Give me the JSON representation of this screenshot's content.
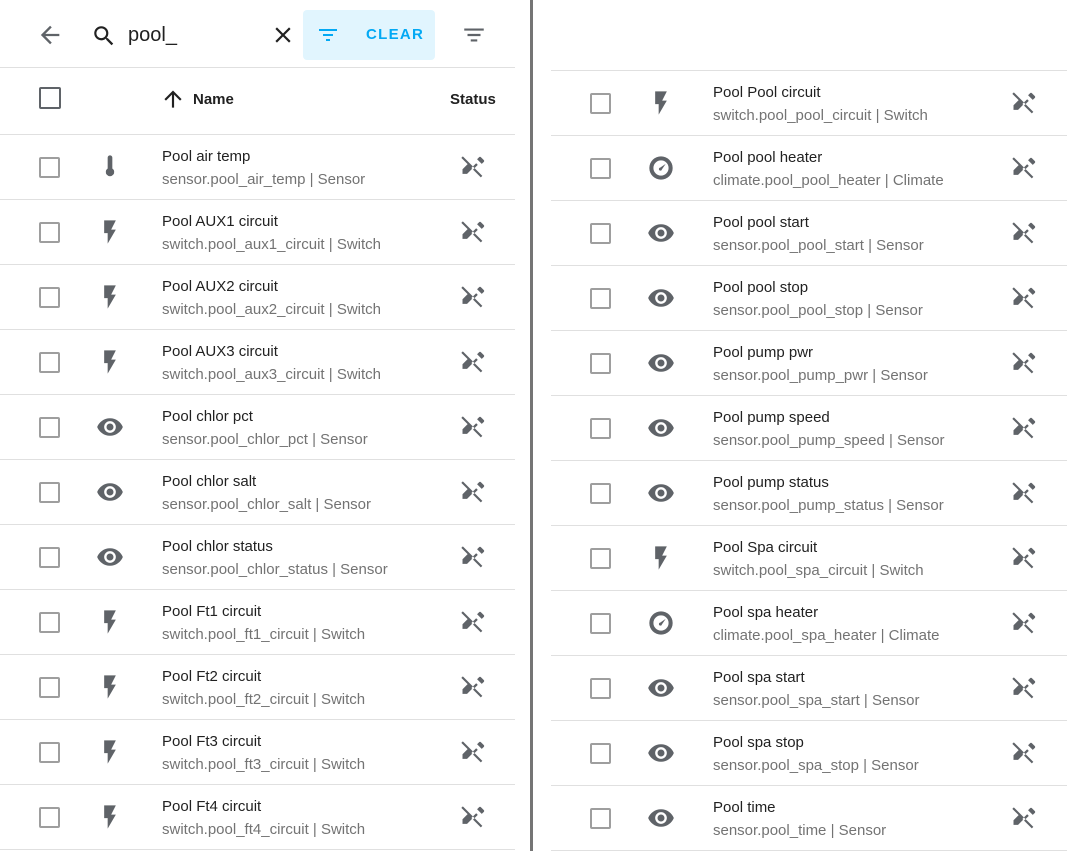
{
  "search": {
    "value": "pool_"
  },
  "toolbar": {
    "clear_label": "CLEAR"
  },
  "header": {
    "name_label": "Name",
    "status_label": "Status"
  },
  "left_rows": [
    {
      "name": "Pool air temp",
      "entity": "sensor.pool_air_temp | Sensor",
      "icon": "thermometer-icon"
    },
    {
      "name": "Pool AUX1 circuit",
      "entity": "switch.pool_aux1_circuit | Switch",
      "icon": "flash-icon"
    },
    {
      "name": "Pool AUX2 circuit",
      "entity": "switch.pool_aux2_circuit | Switch",
      "icon": "flash-icon"
    },
    {
      "name": "Pool AUX3 circuit",
      "entity": "switch.pool_aux3_circuit | Switch",
      "icon": "flash-icon"
    },
    {
      "name": "Pool chlor pct",
      "entity": "sensor.pool_chlor_pct | Sensor",
      "icon": "eye-icon"
    },
    {
      "name": "Pool chlor salt",
      "entity": "sensor.pool_chlor_salt | Sensor",
      "icon": "eye-icon"
    },
    {
      "name": "Pool chlor status",
      "entity": "sensor.pool_chlor_status | Sensor",
      "icon": "eye-icon"
    },
    {
      "name": "Pool Ft1 circuit",
      "entity": "switch.pool_ft1_circuit | Switch",
      "icon": "flash-icon"
    },
    {
      "name": "Pool Ft2 circuit",
      "entity": "switch.pool_ft2_circuit | Switch",
      "icon": "flash-icon"
    },
    {
      "name": "Pool Ft3 circuit",
      "entity": "switch.pool_ft3_circuit | Switch",
      "icon": "flash-icon"
    },
    {
      "name": "Pool Ft4 circuit",
      "entity": "switch.pool_ft4_circuit | Switch",
      "icon": "flash-icon"
    }
  ],
  "right_rows": [
    {
      "name": "Pool Pool circuit",
      "entity": "switch.pool_pool_circuit | Switch",
      "icon": "flash-icon"
    },
    {
      "name": "Pool pool heater",
      "entity": "climate.pool_pool_heater | Climate",
      "icon": "thermostat-icon"
    },
    {
      "name": "Pool pool start",
      "entity": "sensor.pool_pool_start | Sensor",
      "icon": "eye-icon"
    },
    {
      "name": "Pool pool stop",
      "entity": "sensor.pool_pool_stop | Sensor",
      "icon": "eye-icon"
    },
    {
      "name": "Pool pump pwr",
      "entity": "sensor.pool_pump_pwr | Sensor",
      "icon": "eye-icon"
    },
    {
      "name": "Pool pump speed",
      "entity": "sensor.pool_pump_speed | Sensor",
      "icon": "eye-icon"
    },
    {
      "name": "Pool pump status",
      "entity": "sensor.pool_pump_status | Sensor",
      "icon": "eye-icon"
    },
    {
      "name": "Pool Spa circuit",
      "entity": "switch.pool_spa_circuit | Switch",
      "icon": "flash-icon"
    },
    {
      "name": "Pool spa heater",
      "entity": "climate.pool_spa_heater | Climate",
      "icon": "thermostat-icon"
    },
    {
      "name": "Pool spa start",
      "entity": "sensor.pool_spa_start | Sensor",
      "icon": "eye-icon"
    },
    {
      "name": "Pool spa stop",
      "entity": "sensor.pool_spa_stop | Sensor",
      "icon": "eye-icon"
    },
    {
      "name": "Pool time",
      "entity": "sensor.pool_time | Sensor",
      "icon": "eye-icon"
    }
  ],
  "status_icon": "pencil-off-icon",
  "colors": {
    "accent": "#03a9f4",
    "accent_bg": "#e1f5fe",
    "icon": "#5f6368",
    "secondary_text": "#737373"
  }
}
